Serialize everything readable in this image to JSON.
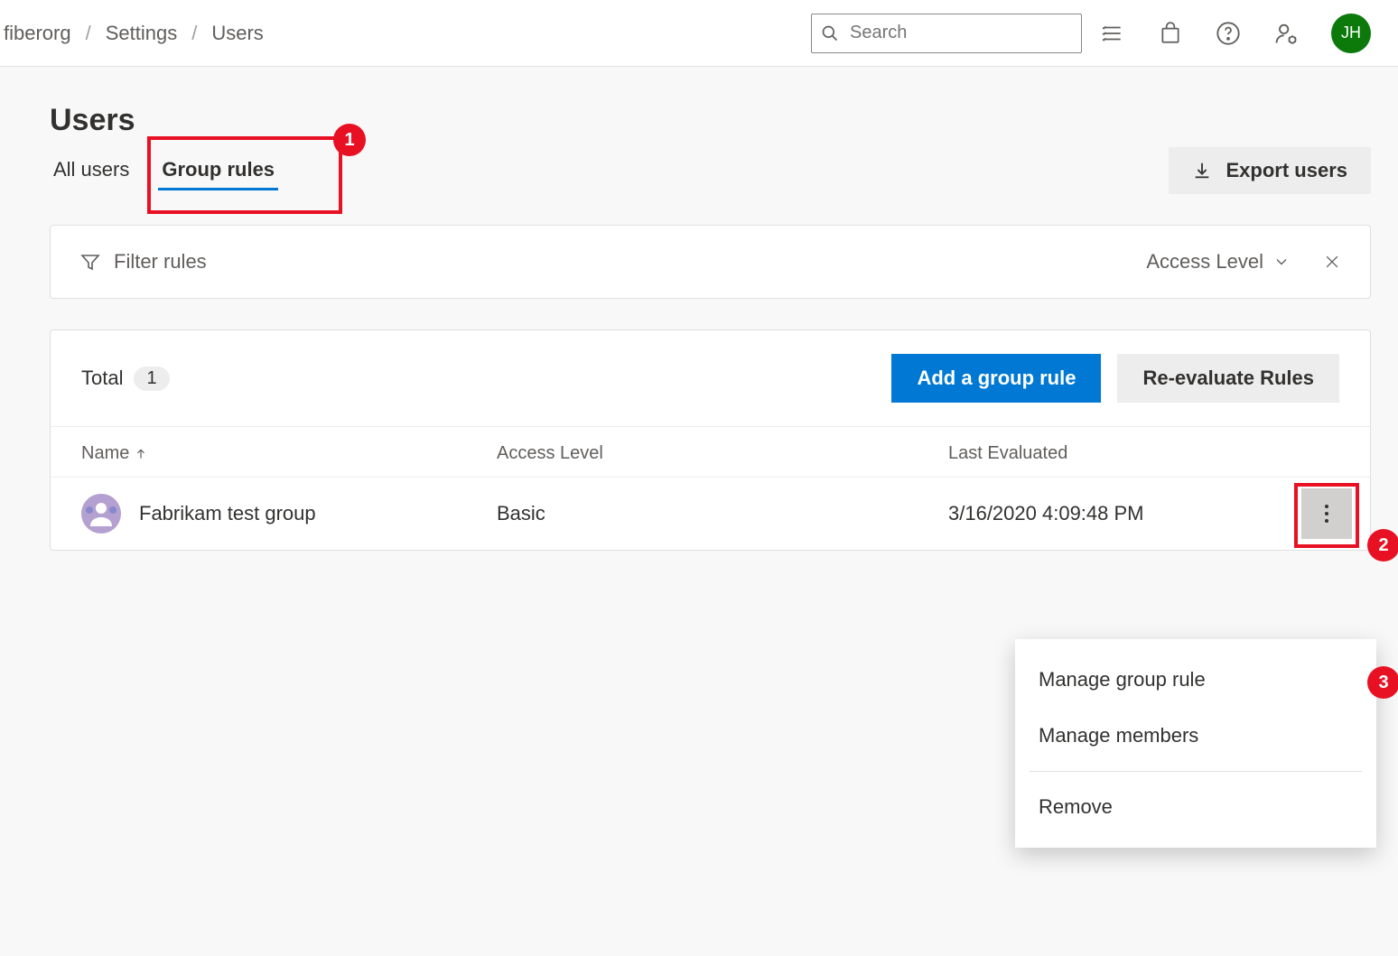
{
  "header": {
    "breadcrumb": [
      "fiberorg",
      "Settings",
      "Users"
    ],
    "search_placeholder": "Search",
    "avatar_initials": "JH"
  },
  "page": {
    "title": "Users",
    "tabs": {
      "all_users": "All users",
      "group_rules": "Group rules"
    },
    "export_button": "Export users"
  },
  "filter": {
    "placeholder": "Filter rules",
    "access_level_label": "Access Level"
  },
  "table": {
    "total_label": "Total",
    "total_count": "1",
    "add_button": "Add a group rule",
    "reevaluate_button": "Re-evaluate Rules",
    "columns": {
      "name": "Name",
      "access": "Access Level",
      "evaluated": "Last Evaluated"
    },
    "rows": [
      {
        "name": "Fabrikam test group",
        "access": "Basic",
        "evaluated": "3/16/2020 4:09:48 PM"
      }
    ]
  },
  "context_menu": {
    "manage_rule": "Manage group rule",
    "manage_members": "Manage members",
    "remove": "Remove"
  },
  "callouts": {
    "c1": "1",
    "c2": "2",
    "c3": "3"
  }
}
